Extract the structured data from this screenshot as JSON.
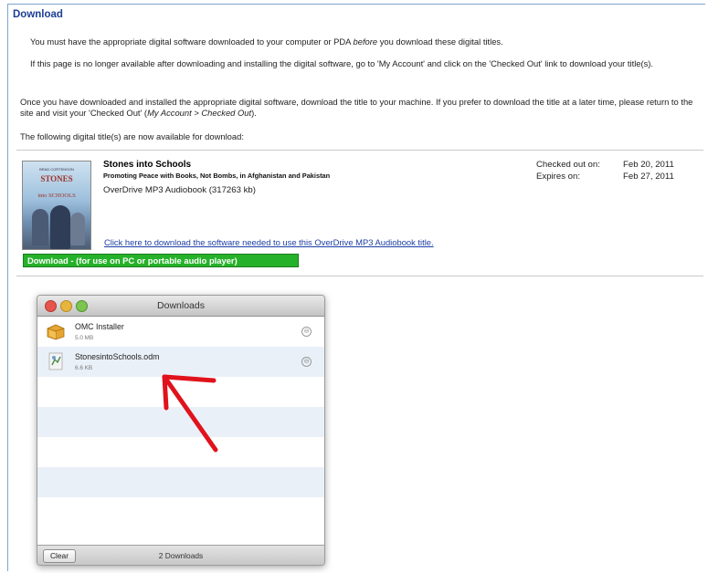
{
  "page": {
    "heading": "Download",
    "paragraph1_before": "You must have the appropriate digital software downloaded to your computer or PDA ",
    "paragraph1_emph": "before",
    "paragraph1_after": " you download these digital titles.",
    "paragraph2": "If this page is no longer available after downloading and installing the digital software, go to 'My Account' and click on the 'Checked Out' link to download your title(s).",
    "paragraph3_before": "Once you have downloaded and installed the appropriate digital software, download the title to your machine. If you prefer to download the title at a later time, please return to the site and visit your 'Checked Out' (",
    "paragraph3_emph": "My Account > Checked Out",
    "paragraph3_after": ").",
    "paragraph4": "The following digital title(s) are now available for download:"
  },
  "title_item": {
    "cover_top_text": "BRAD CORTENSON",
    "cover_title": "STONES",
    "cover_title2": "into",
    "cover_title3": "SCHOOLS",
    "title": "Stones into Schools",
    "subtitle": "Promoting Peace with Books, Not Bombs, in Afghanistan and Pakistan",
    "format": "OverDrive MP3 Audiobook (317263 kb)",
    "checked_out_label": "Checked out on:",
    "checked_out_date": "Feb 20, 2011",
    "expires_label": "Expires on:",
    "expires_date": "Feb 27, 2011",
    "software_link": "Click here to download the software needed to use this OverDrive MP3 Audiobook title.",
    "download_button": "Download - (for use on PC or portable audio player)"
  },
  "downloads_window": {
    "title": "Downloads",
    "items": [
      {
        "name": "OMC Installer",
        "size": "5.0 MB",
        "icon": "package-icon"
      },
      {
        "name": "StonesintoSchools.odm",
        "size": "6.6 KB",
        "icon": "odm-file-icon"
      }
    ],
    "clear_label": "Clear",
    "count_label": "2 Downloads"
  },
  "colors": {
    "heading": "#1c3f94",
    "link": "#1d3fa3",
    "download_button": "#26b12a",
    "annotation_arrow": "#e0121b"
  }
}
